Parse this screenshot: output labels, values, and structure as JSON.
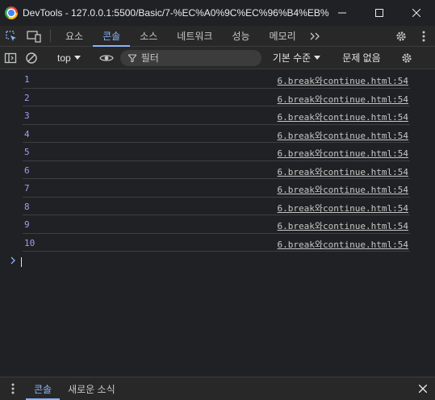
{
  "window": {
    "title": "DevTools - 127.0.0.1:5500/Basic/7-%EC%A0%9C%EC%96%B4%EB%..."
  },
  "tabs": [
    {
      "label": "요소"
    },
    {
      "label": "콘솔"
    },
    {
      "label": "소스"
    },
    {
      "label": "네트워크"
    },
    {
      "label": "성능"
    },
    {
      "label": "메모리"
    }
  ],
  "console_toolbar": {
    "context": "top",
    "filter_placeholder": "필터",
    "levels": "기본 수준",
    "issues": "문제 없음"
  },
  "messages": [
    {
      "value": "1",
      "source": "6.break와continue.html:54"
    },
    {
      "value": "2",
      "source": "6.break와continue.html:54"
    },
    {
      "value": "3",
      "source": "6.break와continue.html:54"
    },
    {
      "value": "4",
      "source": "6.break와continue.html:54"
    },
    {
      "value": "5",
      "source": "6.break와continue.html:54"
    },
    {
      "value": "6",
      "source": "6.break와continue.html:54"
    },
    {
      "value": "7",
      "source": "6.break와continue.html:54"
    },
    {
      "value": "8",
      "source": "6.break와continue.html:54"
    },
    {
      "value": "9",
      "source": "6.break와continue.html:54"
    },
    {
      "value": "10",
      "source": "6.break와continue.html:54"
    }
  ],
  "drawer": {
    "tabs": [
      {
        "label": "콘솔"
      },
      {
        "label": "새로운 소식"
      }
    ]
  },
  "colors": {
    "accent": "#8ab4f8",
    "value": "#9e9ef5",
    "background": "#202124"
  }
}
